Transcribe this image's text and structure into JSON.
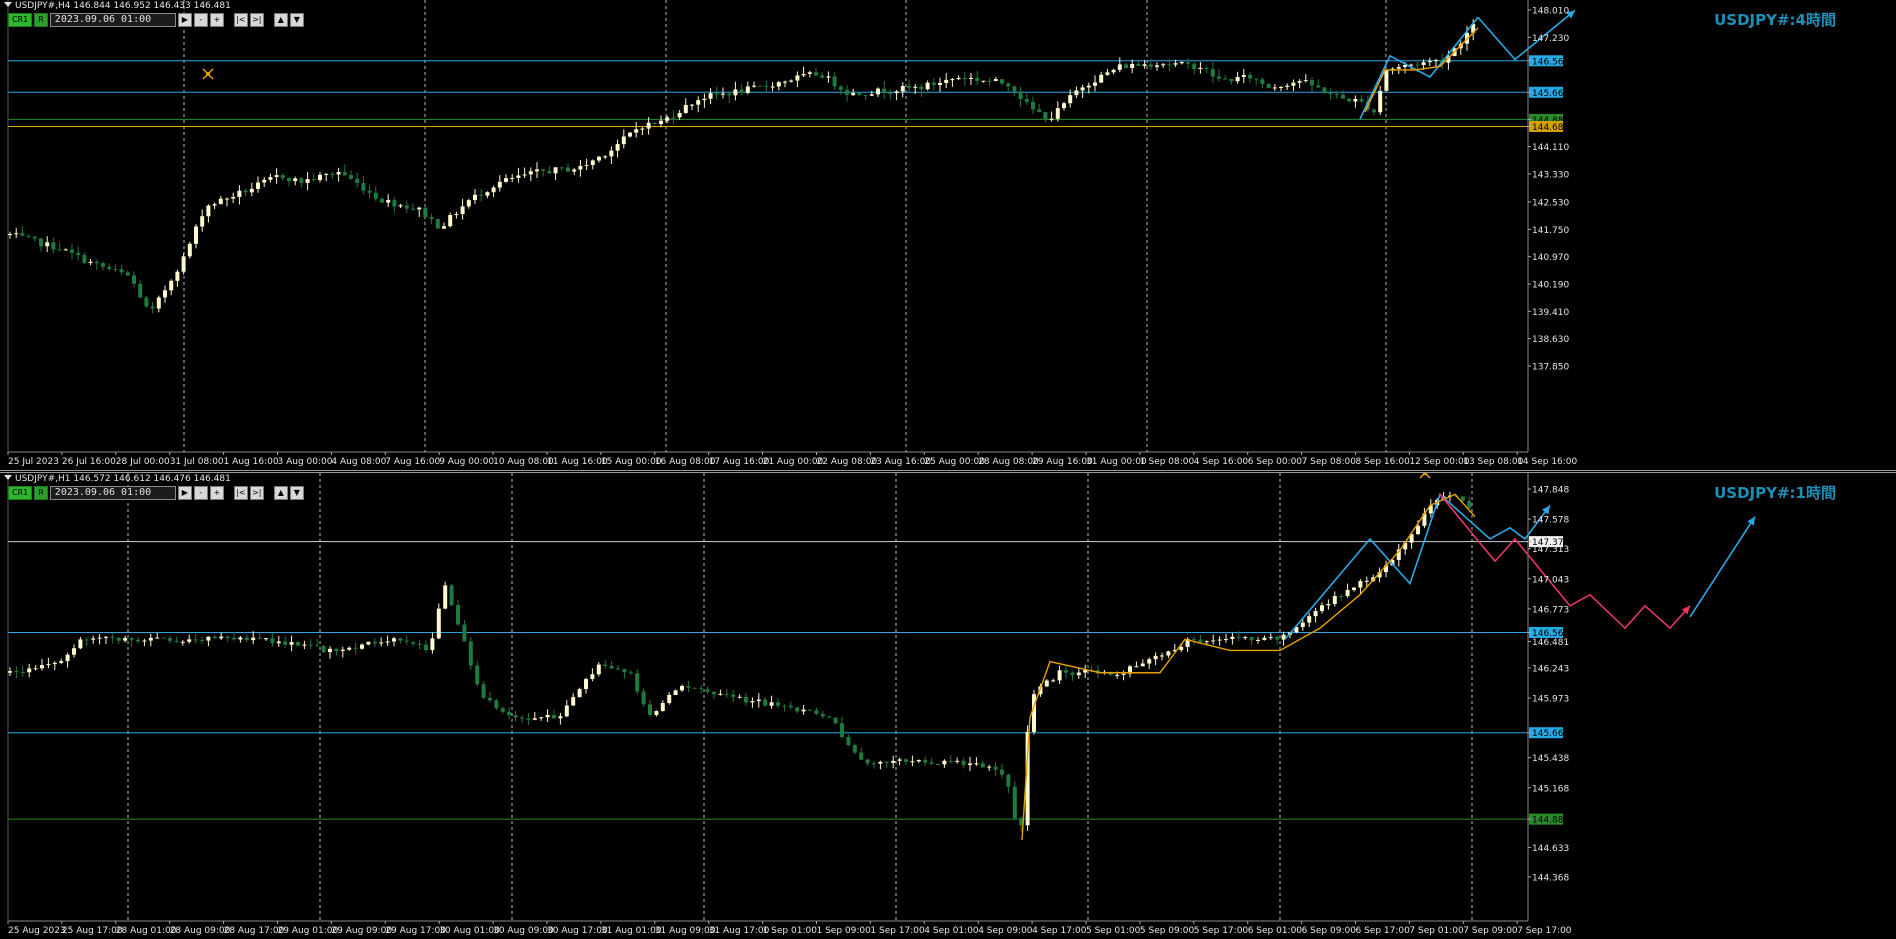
{
  "top": {
    "header": "USDJPY#,H4  146.844 146.952 146.433 146.481",
    "toolbar": {
      "cr": "CR1",
      "r": "R",
      "date": "2023.09.06 01:00",
      "b1": "▶",
      "b2": "-",
      "b3": "+",
      "b4": "|<",
      "b5": ">|",
      "b6": "▲",
      "b7": "▼"
    },
    "watermark": "USDJPY#:4時間",
    "price_labels": [
      "148.010",
      "147.230",
      "146.561",
      "145.662",
      "144.887",
      "144.685",
      "144.110",
      "143.330",
      "142.530",
      "141.750",
      "140.970",
      "140.190",
      "139.410",
      "138.630",
      "137.850"
    ],
    "time_labels": [
      "25 Jul 2023",
      "26 Jul 16:00",
      "28 Jul 00:00",
      "31 Jul 08:00",
      "1 Aug 16:00",
      "3 Aug 00:00",
      "4 Aug 08:00",
      "7 Aug 16:00",
      "9 Aug 00:00",
      "10 Aug 08:00",
      "11 Aug 16:00",
      "15 Aug 00:00",
      "16 Aug 08:00",
      "17 Aug 16:00",
      "21 Aug 00:00",
      "22 Aug 08:00",
      "23 Aug 16:00",
      "25 Aug 00:00",
      "28 Aug 08:00",
      "29 Aug 16:00",
      "31 Aug 00:00",
      "1 Sep 08:00",
      "4 Sep 16:00",
      "6 Sep 00:00",
      "7 Sep 08:00",
      "8 Sep 16:00",
      "12 Sep 00:00",
      "13 Sep 08:00",
      "14 Sep 16:00"
    ]
  },
  "bottom": {
    "header": "USDJPY#,H1  146.572 146.612 146.476 146.481",
    "toolbar": {
      "cr": "CR1",
      "r": "R",
      "date": "2023.09.06 01:00",
      "b1": "▶",
      "b2": "-",
      "b3": "+",
      "b4": "|<",
      "b5": ">|",
      "b6": "▲",
      "b7": "▼"
    },
    "watermark": "USDJPY#:1時間",
    "price_labels": [
      "147.848",
      "147.578",
      "147.376",
      "147.313",
      "147.043",
      "146.773",
      "146.561",
      "146.481",
      "146.243",
      "145.973",
      "145.662",
      "145.438",
      "145.168",
      "144.887",
      "144.633",
      "144.368"
    ],
    "time_labels": [
      "25 Aug 2023",
      "25 Aug 17:00",
      "28 Aug 01:00",
      "28 Aug 09:00",
      "28 Aug 17:00",
      "29 Aug 01:00",
      "29 Aug 09:00",
      "29 Aug 17:00",
      "30 Aug 01:00",
      "30 Aug 09:00",
      "30 Aug 17:00",
      "31 Aug 01:00",
      "31 Aug 09:00",
      "31 Aug 17:00",
      "1 Sep 01:00",
      "1 Sep 09:00",
      "1 Sep 17:00",
      "4 Sep 01:00",
      "4 Sep 09:00",
      "4 Sep 17:00",
      "5 Sep 01:00",
      "5 Sep 09:00",
      "5 Sep 17:00",
      "6 Sep 01:00",
      "6 Sep 09:00",
      "6 Sep 17:00",
      "7 Sep 01:00",
      "7 Sep 09:00",
      "7 Sep 17:00"
    ]
  },
  "colors": {
    "bull": "#fffacd",
    "bear": "#1f7a3f",
    "blue_line": "#2aa8e6",
    "white_line": "#cfcfcf",
    "green_line": "#2b8a2b",
    "orange_line": "#e8a000",
    "pink_line": "#e8346a",
    "grid": "#d8d8d8",
    "label_blue_bg": "#27a9e1",
    "label_green_bg": "#2b8a2b",
    "label_orange_bg": "#d4a000",
    "label_white_bg": "#f0f0f0"
  },
  "icons": {
    "drawing_tool": "pencil-compass-icon"
  }
}
